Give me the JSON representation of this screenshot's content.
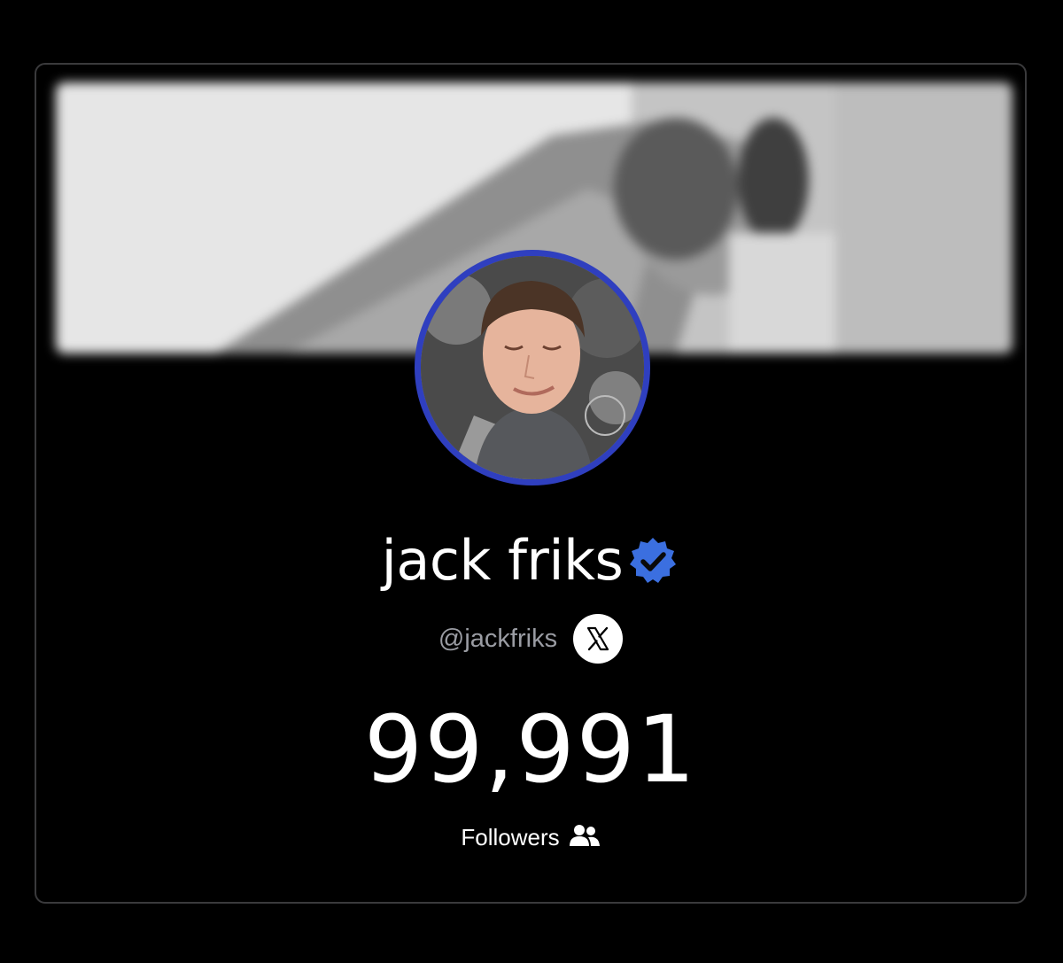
{
  "profile": {
    "display_name": "jack friks",
    "handle": "@jackfriks",
    "platform": "X",
    "verified": true,
    "follower_count": "99,991",
    "followers_label": "Followers"
  },
  "icons": {
    "verified": "verified-check-icon",
    "platform": "x-logo-icon",
    "followers": "users-icon"
  },
  "colors": {
    "background": "#000000",
    "card_border": "#3a3a3c",
    "avatar_ring": "#2f3fbf",
    "verified_badge": "#3b6fe0",
    "handle_text": "#9a9ca3"
  }
}
